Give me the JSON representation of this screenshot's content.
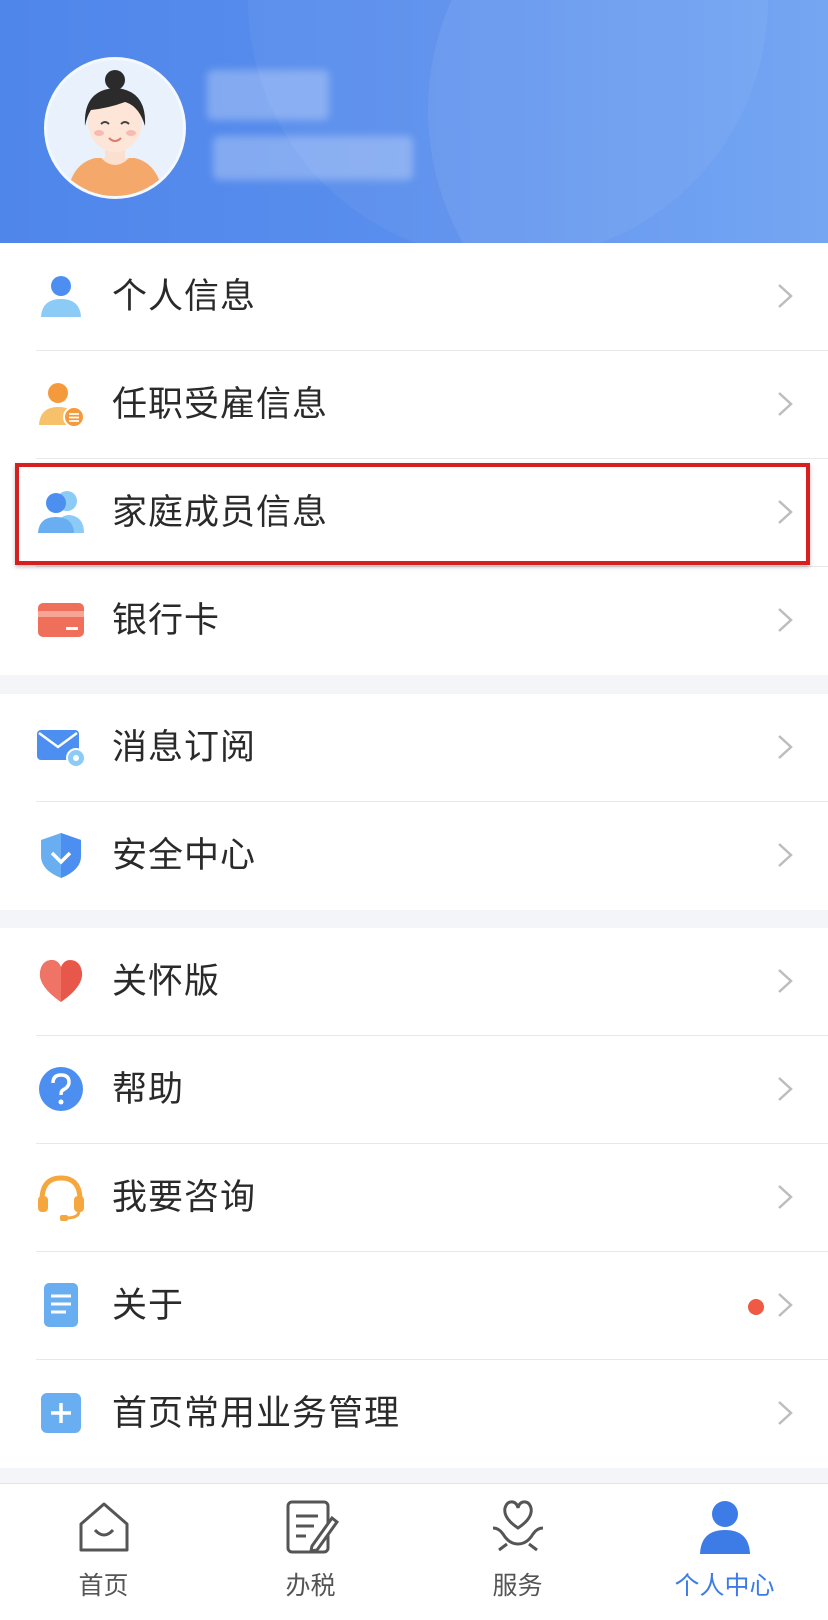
{
  "header": {
    "user_name": "",
    "user_id": ""
  },
  "groups": [
    {
      "items": [
        {
          "label": "个人信息",
          "icon": "person-icon"
        },
        {
          "label": "任职受雇信息",
          "icon": "employment-icon"
        },
        {
          "label": "家庭成员信息",
          "icon": "family-icon",
          "highlighted": true
        },
        {
          "label": "银行卡",
          "icon": "bank-card-icon"
        }
      ]
    },
    {
      "items": [
        {
          "label": "消息订阅",
          "icon": "message-subscribe-icon"
        },
        {
          "label": "安全中心",
          "icon": "shield-icon"
        }
      ]
    },
    {
      "items": [
        {
          "label": "关怀版",
          "icon": "heart-icon"
        },
        {
          "label": "帮助",
          "icon": "help-icon"
        },
        {
          "label": "我要咨询",
          "icon": "headset-icon"
        },
        {
          "label": "关于",
          "icon": "document-icon",
          "badge_dot": true
        },
        {
          "label": "首页常用业务管理",
          "icon": "plus-icon"
        }
      ]
    }
  ],
  "tabbar": [
    {
      "label": "首页",
      "icon": "home-icon",
      "active": false
    },
    {
      "label": "办税",
      "icon": "tax-icon",
      "active": false
    },
    {
      "label": "服务",
      "icon": "service-icon",
      "active": false
    },
    {
      "label": "个人中心",
      "icon": "profile-icon",
      "active": true
    }
  ],
  "colors": {
    "accent": "#3d7be6",
    "header": "#5389ec",
    "highlight": "#d81f1f",
    "badge": "#ef5a45"
  }
}
